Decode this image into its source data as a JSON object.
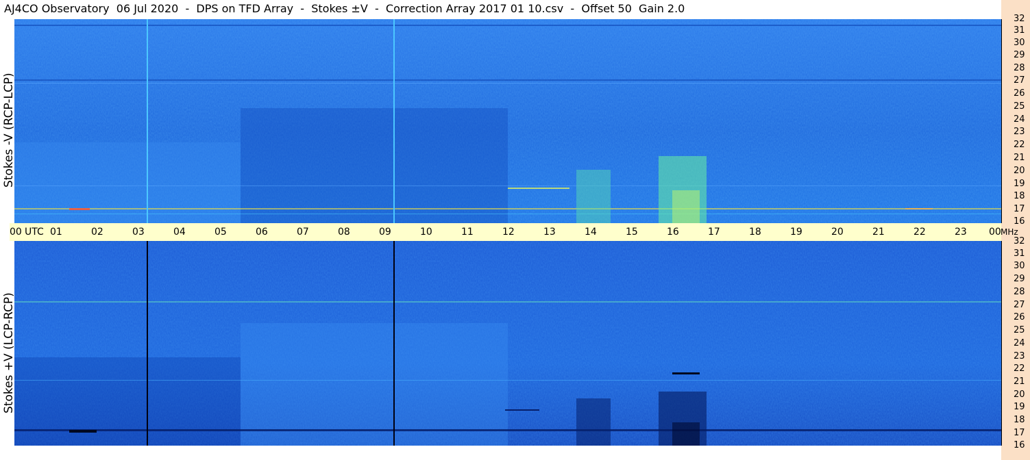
{
  "title": "AJ4CO Observatory  06 Jul 2020  -  DPS on TFD Array  -  Stokes ±V  -  Correction Array 2017 01 10.csv  -  Offset 50  Gain 2.0",
  "panels": {
    "top": {
      "label": "Stokes -V (RCP-LCP)"
    },
    "bottom": {
      "label": "Stokes +V (LCP-RCP)"
    }
  },
  "time_axis": {
    "ticks": [
      "00",
      "UTC",
      "01",
      "02",
      "03",
      "04",
      "05",
      "06",
      "07",
      "08",
      "09",
      "10",
      "11",
      "12",
      "13",
      "14",
      "15",
      "16",
      "17",
      "18",
      "19",
      "20",
      "21",
      "22",
      "23",
      "00",
      "MHz"
    ]
  },
  "frequency_axis": {
    "ticks": [
      "32",
      "31",
      "30",
      "29",
      "28",
      "27",
      "26",
      "25",
      "24",
      "23",
      "22",
      "21",
      "20",
      "19",
      "18",
      "17",
      "16"
    ]
  },
  "colors": {
    "background_blue": "#1a6ee0",
    "dark_blue": "#0b3fb0",
    "time_bar": "#ffffcc",
    "scale_strip": "#fbe0c6"
  }
}
